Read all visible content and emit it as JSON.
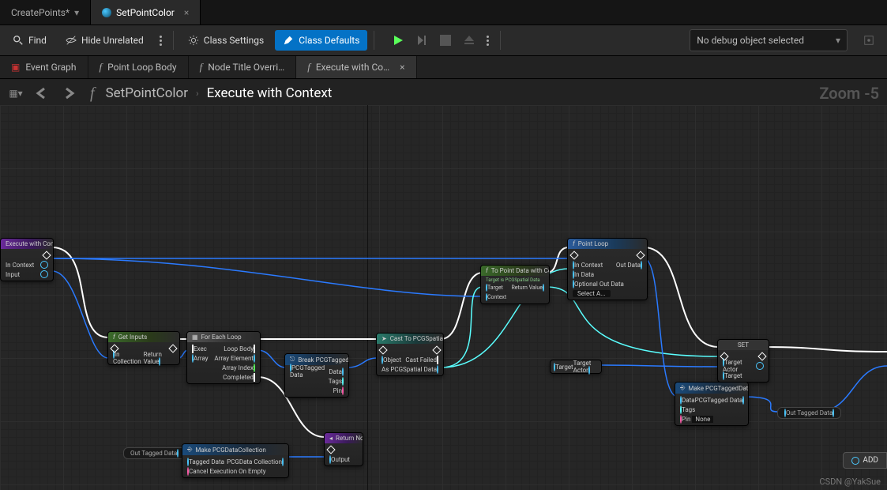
{
  "assetTabs": [
    {
      "label": "CreatePoints*",
      "active": false
    },
    {
      "label": "SetPointColor",
      "active": true
    }
  ],
  "toolbar": {
    "find": "Find",
    "hideUnrelated": "Hide Unrelated",
    "classSettings": "Class Settings",
    "classDefaults": "Class Defaults",
    "debugSelect": "No debug object selected"
  },
  "graphTabs": [
    {
      "label": "Event Graph",
      "icon": "event"
    },
    {
      "label": "Point Loop Body",
      "icon": "f"
    },
    {
      "label": "Node Title Overri…",
      "icon": "f"
    },
    {
      "label": "Execute with Co…",
      "icon": "f",
      "active": true,
      "closable": true
    }
  ],
  "breadcrumb": {
    "root": "SetPointColor",
    "leaf": "Execute with Context"
  },
  "zoom": "Zoom -5",
  "nodes": {
    "execCtx": {
      "title": "Execute with Context",
      "pins": [
        "In Context",
        "Input"
      ]
    },
    "getInputs": {
      "title": "Get Inputs",
      "in": "In Collection",
      "out": "Return Value"
    },
    "forEach": {
      "title": "For Each Loop",
      "in": [
        "Exec",
        "Array"
      ],
      "out": [
        "Loop Body",
        "Array Element",
        "Array Index",
        "Completed"
      ]
    },
    "breakTagged": {
      "title": "Break PCGTaggedData",
      "in": "PCGTagged Data",
      "out": [
        "Data",
        "Tags",
        "Pin"
      ]
    },
    "returnNode": {
      "title": "Return Node",
      "out": "Output"
    },
    "makeColl": {
      "title": "Make PCGDataCollection",
      "in": [
        "Tagged Data",
        "Cancel Execution On Empty"
      ],
      "out": "PCGData Collection"
    },
    "cast": {
      "title": "Cast To PCGSpatialData",
      "in": "Object",
      "out": [
        "Cast Failed",
        "As PCGSpatial Data"
      ]
    },
    "toPoint": {
      "title": "To Point Data with Context",
      "sub": "Target is PCGSpatial Data",
      "in": [
        "Target",
        "Context"
      ],
      "out": "Return Value"
    },
    "pointLoop": {
      "title": "Point Loop",
      "in": [
        "In Context",
        "In Data",
        "Optional Out Data"
      ],
      "out": "Out Data",
      "extra": "Select A..."
    },
    "target": {
      "in": "Target",
      "out": "Target Actor"
    },
    "set": {
      "title": "SET",
      "in": [
        "Target Actor",
        "Target"
      ]
    },
    "makeTagged": {
      "title": "Make PCGTaggedData",
      "in": [
        "Data",
        "Tags",
        "Pin"
      ],
      "out": "PCGTagged Data",
      "pinVal": "None"
    },
    "outTagged1": "Out Tagged Data",
    "outTagged2": "Out Tagged Data",
    "addBtn": "ADD"
  },
  "watermark": "CSDN @YakSue"
}
